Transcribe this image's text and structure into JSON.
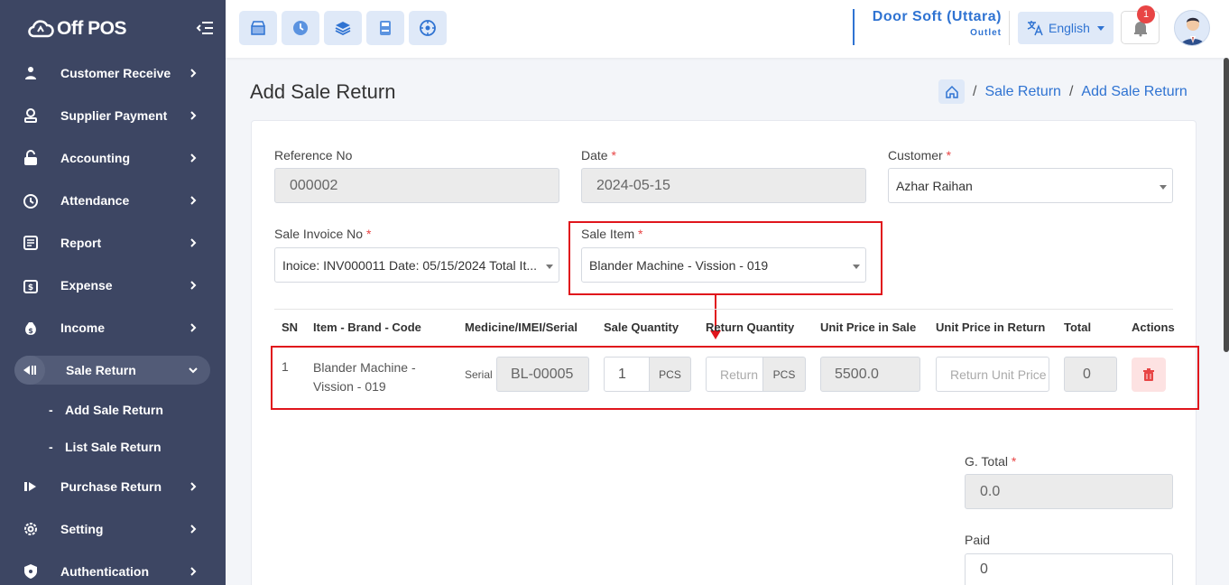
{
  "app": {
    "logo_text": "Off POS"
  },
  "sidebar": {
    "items": [
      {
        "label": "Customer Receive",
        "icon": "customer-receive-icon"
      },
      {
        "label": "Supplier Payment",
        "icon": "supplier-payment-icon"
      },
      {
        "label": "Accounting",
        "icon": "lock-icon"
      },
      {
        "label": "Attendance",
        "icon": "clock-icon"
      },
      {
        "label": "Report",
        "icon": "report-icon"
      },
      {
        "label": "Expense",
        "icon": "expense-icon"
      },
      {
        "label": "Income",
        "icon": "income-icon"
      },
      {
        "label": "Sale Return",
        "icon": "sale-return-icon",
        "active": true
      },
      {
        "label": "Purchase Return",
        "icon": "purchase-return-icon"
      },
      {
        "label": "Setting",
        "icon": "gear-icon"
      },
      {
        "label": "Authentication",
        "icon": "shield-icon"
      }
    ],
    "submenu": [
      {
        "label": "Add Sale Return"
      },
      {
        "label": "List Sale Return"
      }
    ]
  },
  "header": {
    "quick_icons": [
      "pos-icon",
      "clock-icon",
      "layers-icon",
      "calculator-icon",
      "dashboard-icon"
    ],
    "outlet_name": "Door Soft (Uttara)",
    "outlet_sub": "Outlet",
    "language": "English",
    "notification_count": "1"
  },
  "page": {
    "title": "Add Sale Return",
    "breadcrumb": [
      "Sale Return",
      "Add Sale Return"
    ]
  },
  "form": {
    "reference_label": "Reference No",
    "reference_value": "000002",
    "date_label": "Date",
    "date_value": "2024-05-15",
    "customer_label": "Customer",
    "customer_value": "Azhar Raihan",
    "invoice_label": "Sale Invoice No",
    "invoice_value": "Inoice: INV000011 Date: 05/15/2024 Total It...",
    "sale_item_label": "Sale Item",
    "sale_item_value": "Blander Machine - Vission - 019",
    "required_mark": "*"
  },
  "table": {
    "headers": [
      "SN",
      "Item - Brand - Code",
      "Medicine/IMEI/Serial",
      "Sale Quantity",
      "Return Quantity",
      "Unit Price in Sale",
      "Unit Price in Return",
      "Total",
      "Actions"
    ],
    "row": {
      "sn": "1",
      "item_line1": "Blander Machine -",
      "item_line2": "Vission - 019",
      "serial_label": "Serial",
      "serial_value": "BL-00005",
      "sale_qty": "1",
      "sale_unit": "PCS",
      "return_qty_placeholder": "Return",
      "return_unit": "PCS",
      "unit_price_sale": "5500.0",
      "unit_price_return_placeholder": "Return Unit Price",
      "total": "0"
    }
  },
  "totals": {
    "gtotal_label": "G. Total",
    "gtotal_value": "0.0",
    "paid_label": "Paid",
    "paid_value": "0"
  },
  "colors": {
    "sidebar_bg": "#3d4663",
    "accent": "#2f73d2",
    "highlight_red": "#e0151c"
  }
}
